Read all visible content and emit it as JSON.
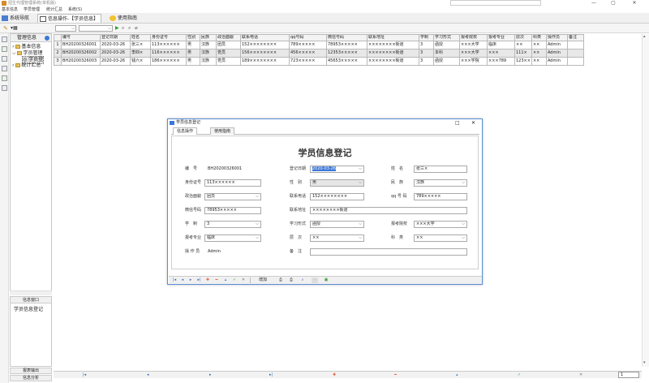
{
  "window": {
    "title": "招生代理管理系统(单机版)",
    "controls": [
      "—",
      "▢",
      "✕"
    ]
  },
  "menu": [
    "基本信息",
    "学员管理",
    "统计汇总",
    "系统(S)"
  ],
  "tabs": [
    "系统导航",
    "信息操作-【学员信息】",
    "使用指南"
  ],
  "tree": {
    "header": "管理信息",
    "nodes": [
      "基本信息",
      "学员管理",
      "学员登",
      "统计汇总"
    ]
  },
  "info_panel": {
    "header": "信息窗口",
    "item": "学员信息登记",
    "footer1": "报表输出",
    "footer2": "信息分析"
  },
  "grid": {
    "columns": [
      "编号",
      "登记日期",
      "姓名",
      "身份证号",
      "性别",
      "民族",
      "政治面貌",
      "联系电话",
      "qq号码",
      "微信号码",
      "联系地址",
      "学制",
      "学习形式",
      "报考院校",
      "报考专业",
      "层次",
      "科类",
      "操作员",
      "备注"
    ],
    "rows": [
      {
        "idx": "1",
        "cells": [
          "BH20200326001",
          "2020-03-26",
          "张三×",
          "113××××××",
          "男",
          "汉族",
          "团员",
          "152××××××××",
          "789×××××",
          "78953×××××",
          "××××××××街道",
          "3",
          "函授",
          "×××大学",
          "临床",
          "××",
          "××",
          "Admin",
          ""
        ]
      },
      {
        "idx": "2",
        "cells": [
          "BH20200326002",
          "2020-03-26",
          "李四×",
          "116××××××",
          "男",
          "汉族",
          "党员",
          "156××××××××",
          "456×××××",
          "12353×××××",
          "××××××××街道",
          "3",
          "本科",
          "×××大学",
          "×××",
          "111×",
          "××",
          "Admin",
          ""
        ]
      },
      {
        "idx": "3",
        "cells": [
          "BH20200326003",
          "2020-03-26",
          "钱六×",
          "186××××××",
          "男",
          "汉族",
          "党员",
          "189××××××××",
          "723×××××",
          "45653×××××",
          "××××××××街道",
          "3",
          "函授",
          "×××学院",
          "×××789",
          "123××",
          "××",
          "Admin",
          ""
        ]
      }
    ]
  },
  "dialog": {
    "title": "学员信息登记",
    "tabs": [
      "信息操作",
      "使用指南"
    ],
    "form_title": "学员信息登记",
    "fields": {
      "bianhao_label": "编　号",
      "bianhao": "BH20200326001",
      "date_label": "登记日期",
      "date": "2020-03-26",
      "name_label": "姓　名",
      "name": "张三×",
      "id_label": "身份证号",
      "id": "113××××××",
      "gender_label": "性　别",
      "gender": "男",
      "nation_label": "民　族",
      "nation": "汉族",
      "politics_label": "政治面貌",
      "politics": "团员",
      "phone_label": "联系电话",
      "phone": "152××××××××",
      "qq_label": "qq 号 码",
      "qq": "789×××××",
      "wechat_label": "微信号码",
      "wechat": "78953×××××",
      "address_label": "联系地址",
      "address": "××××××××街道",
      "xuezhi_label": "学　制",
      "xuezhi": "3",
      "form_label": "学习形式",
      "form": "函授",
      "school_label": "报考院校",
      "school": "×××大学",
      "major_label": "报考专业",
      "major": "临床",
      "level_label": "层　次",
      "level": "××",
      "category_label": "科　类",
      "category": "××",
      "operator_label": "操 作 员",
      "operator": "Admin",
      "remark_label": "备　注",
      "remark": ""
    },
    "toolbar_add": "增加"
  },
  "nav": {
    "page": "1"
  },
  "colors": {
    "accent": "#3c78d8",
    "folder": "#e6c35a"
  }
}
